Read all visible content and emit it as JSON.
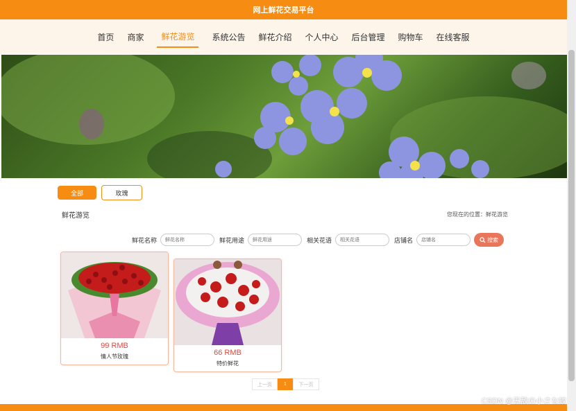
{
  "header": {
    "title": "网上鲜花交易平台"
  },
  "nav": {
    "items": [
      {
        "label": "首页"
      },
      {
        "label": "商家"
      },
      {
        "label": "鲜花游览"
      },
      {
        "label": "系统公告"
      },
      {
        "label": "鲜花介绍"
      },
      {
        "label": "个人中心"
      },
      {
        "label": "后台管理"
      },
      {
        "label": "购物车"
      },
      {
        "label": "在线客服"
      }
    ],
    "active_index": 2
  },
  "banner": {
    "slide_count": 2,
    "active_slide": 1
  },
  "categories": [
    {
      "label": "全部"
    },
    {
      "label": "玫瑰"
    }
  ],
  "section": {
    "title": "鲜花游览",
    "location": "您现在的位置：鲜花游览"
  },
  "search": {
    "name_label": "鲜花名称",
    "name_placeholder": "鲜花名称",
    "use_label": "鲜花用途",
    "use_placeholder": "鲜花用途",
    "lang_label": "相关花语",
    "lang_placeholder": "相关花语",
    "shop_label": "店铺名",
    "shop_placeholder": "店铺名",
    "button_label": "搜索"
  },
  "products": [
    {
      "price": "99 RMB",
      "name": "情人节玫瑰"
    },
    {
      "price": "66 RMB",
      "name": "特价鲜花"
    }
  ],
  "pager": {
    "prev": "上一页",
    "current": "1",
    "next": "下一页"
  },
  "watermark": "CSDN @无敌の小さな蚊",
  "colors": {
    "accent": "#f78c12",
    "nav_bg": "#fdf4ea",
    "price": "#e5433d",
    "search_button": "#e9755a"
  }
}
